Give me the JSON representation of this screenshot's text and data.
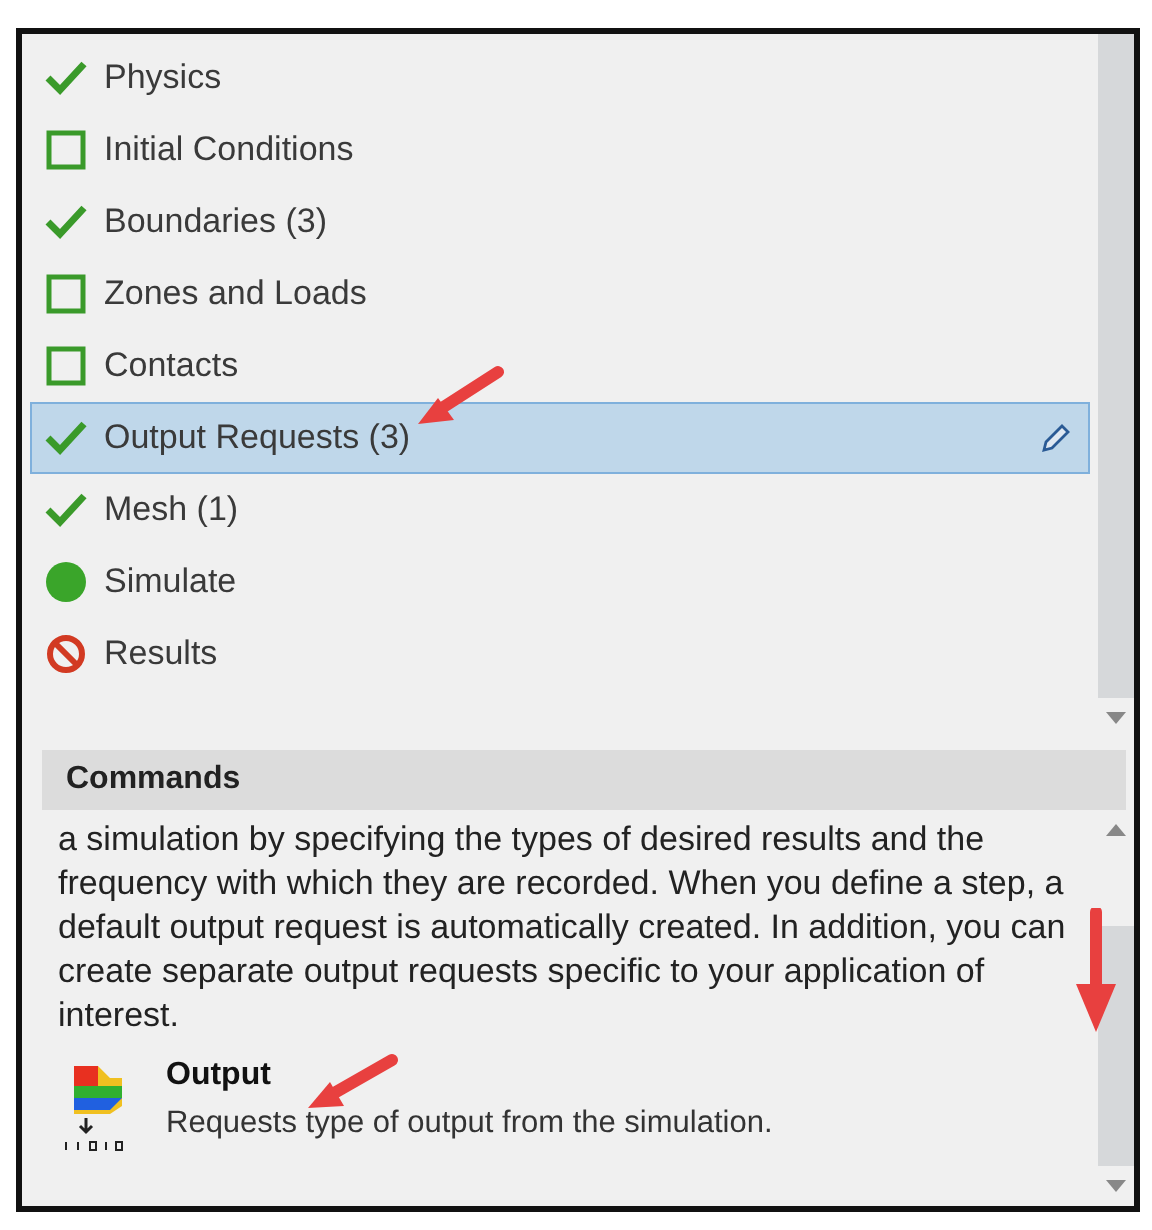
{
  "steps": [
    {
      "label": "Physics",
      "kind": "done",
      "selected": false
    },
    {
      "label": "Initial Conditions",
      "kind": "todo",
      "selected": false
    },
    {
      "label": "Boundaries (3)",
      "kind": "done",
      "selected": false
    },
    {
      "label": "Zones and Loads",
      "kind": "todo",
      "selected": false
    },
    {
      "label": "Contacts",
      "kind": "todo",
      "selected": false
    },
    {
      "label": "Output Requests (3)",
      "kind": "done",
      "selected": true
    },
    {
      "label": "Mesh (1)",
      "kind": "done",
      "selected": false
    },
    {
      "label": "Simulate",
      "kind": "ready",
      "selected": false
    },
    {
      "label": "Results",
      "kind": "blocked",
      "selected": false
    }
  ],
  "commands": {
    "title": "Commands",
    "description": "a simulation by specifying the types of desired results and the frequency with which they are recorded. When you define a step, a default output request is automatically created. In addition, you can create separate output requests specific to your application of interest.",
    "items": [
      {
        "name": "Output",
        "detail": "Requests type of output from the simulation."
      }
    ]
  }
}
